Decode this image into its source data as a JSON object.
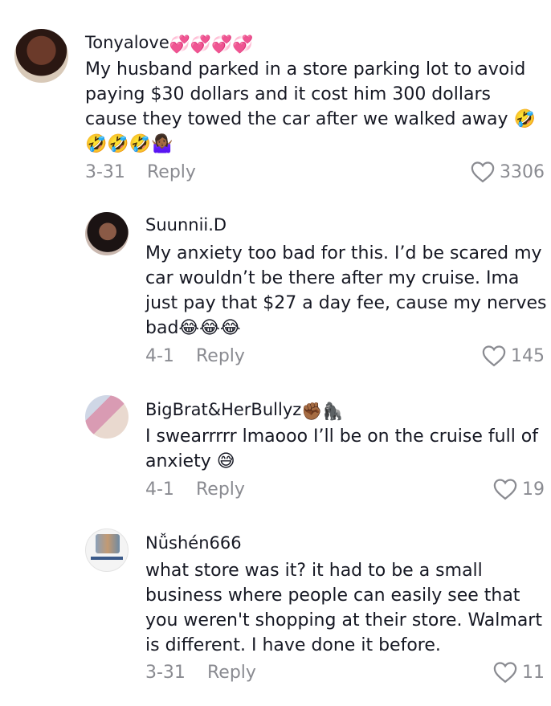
{
  "comments": [
    {
      "username": "Tonyalove",
      "username_emoji": "💞💞💞💞",
      "text_lines": [
        "My husband parked in a store parking lot to avoid",
        "paying $30 dollars and it cost him 300 dollars",
        "cause they towed the car after we walked away 🤣",
        "🤣🤣🤣🤷🏾‍♀️"
      ],
      "date": "3-31",
      "reply_label": "Reply",
      "likes": "3306"
    },
    {
      "username": "Suunnii.D",
      "username_emoji": "",
      "text_lines": [
        "My anxiety too bad for this. I’d be scared my",
        "car wouldn’t be there after my cruise. Ima",
        "just pay that $27 a day fee, cause my nerves",
        "bad😂😂😂"
      ],
      "date": "4-1",
      "reply_label": "Reply",
      "likes": "145"
    },
    {
      "username": "BigBrat&HerBullyz",
      "username_emoji": "✊🏾🦍",
      "text_lines": [
        "I swearrrrr lmaooo I’ll be on the cruise full of",
        "anxiety 😅"
      ],
      "date": "4-1",
      "reply_label": "Reply",
      "likes": "19"
    },
    {
      "username": "Nǚshén666",
      "username_emoji": "",
      "text_lines": [
        "what store was it? it had to be a small",
        "business where people can easily see that",
        "you weren't shopping at their store. Walmart",
        "is different. I have done it before."
      ],
      "date": "3-31",
      "reply_label": "Reply",
      "likes": "11"
    }
  ]
}
